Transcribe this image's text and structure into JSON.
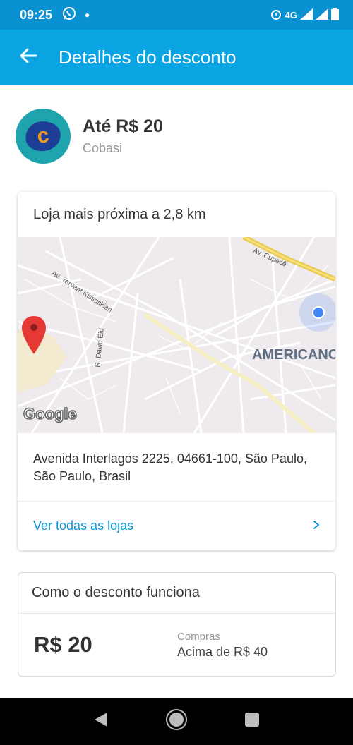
{
  "status_bar": {
    "time": "09:25",
    "network": "4G"
  },
  "app_bar": {
    "title": "Detalhes do desconto"
  },
  "store": {
    "discount": "Até R$ 20",
    "name": "Cobasi",
    "logo_letter": "c"
  },
  "nearest_store": {
    "title": "Loja mais próxima a 2,8 km",
    "map": {
      "street_labels": [
        "Av. Yervant Kissajikian",
        "Av. Cupecê",
        "R. David Eid"
      ],
      "area_label": "AMERICANO",
      "google_label": "Google"
    },
    "address": "Avenida Interlagos 2225, 04661-100, São Paulo, São Paulo, Brasil",
    "see_all_label": "Ver todas as lojas"
  },
  "how_it_works": {
    "title": "Como o desconto funciona",
    "amount": "R$ 20",
    "condition_label": "Compras",
    "condition_value": "Acima de R$ 40"
  },
  "colors": {
    "status_bar": "#0a91d1",
    "app_bar": "#0aa4e3",
    "link": "#0a96d6",
    "pin": "#e53935",
    "logo_bg": "#1fa3ad",
    "logo_blob": "#1c3f95",
    "logo_letter": "#f29a1f"
  },
  "icons": {
    "back": "arrow-back-icon",
    "whatsapp": "whatsapp-icon",
    "alarm": "alarm-icon",
    "signal": "signal-icon",
    "battery": "battery-icon",
    "pin": "map-pin-icon",
    "location": "my-location-icon",
    "chevron": "chevron-right-icon",
    "nav_back": "nav-back-icon",
    "nav_home": "nav-home-icon",
    "nav_recents": "nav-recents-icon"
  }
}
